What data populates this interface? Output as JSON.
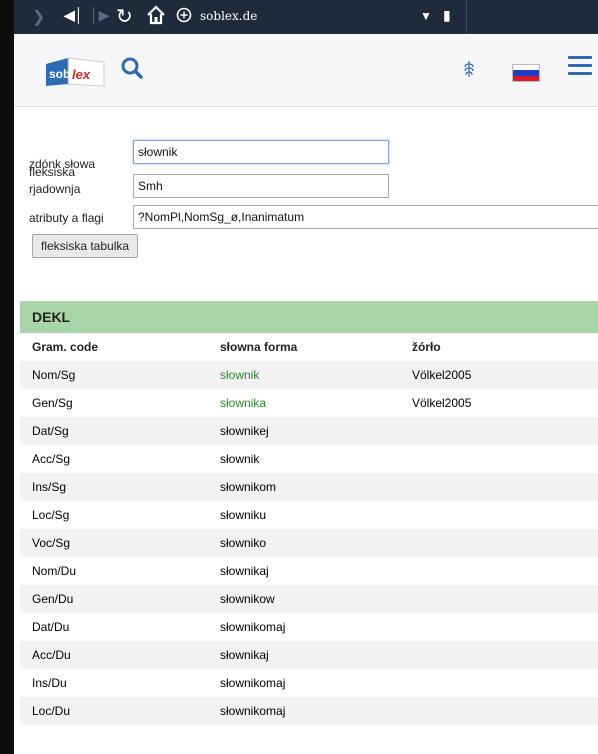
{
  "browser": {
    "domain": "soblex.de",
    "forward_icon": "chevron-right-icon",
    "skip_back_icon": "skip-back-icon",
    "skip_forward_icon": "skip-forward-icon",
    "reload_icon": "reload-icon",
    "home_icon": "home-icon",
    "site_icon": "site-info-icon",
    "dropdown_icon": "dropdown-icon",
    "bookmark_icon": "bookmark-icon",
    "bar_color": "#1d2b3a"
  },
  "header": {
    "logo_part1": "sob",
    "logo_part2": "lex",
    "search_icon": "search-icon",
    "language_icon": "sorbian-language-icon",
    "flag_icon": "russian-flag-icon",
    "menu_icon": "hamburger-menu-icon",
    "accent_color": "#2b6cb5"
  },
  "form": {
    "stem_label": "zdónk słowa",
    "stem_value": "słownik",
    "inflection_label_line1": "fleksiska",
    "inflection_label_line2": "rjadownja",
    "inflection_value": "Smh",
    "attributes_label": "atributy a flagi",
    "attributes_value": "?NomPl,NomSg_ø,Inanimatum",
    "table_button": "fleksiska tabulka"
  },
  "table": {
    "group": "DEKL",
    "group_color": "#a9d6a9",
    "headers": {
      "code": "Gram. code",
      "form": "słowna forma",
      "source": "žórło"
    },
    "rows": [
      {
        "code": "Nom/Sg",
        "form": "słownik",
        "source": "Völkel2005"
      },
      {
        "code": "Gen/Sg",
        "form": "słownika",
        "source": "Völkel2005"
      },
      {
        "code": "Dat/Sg",
        "form": "słownikej",
        "source": ""
      },
      {
        "code": "Acc/Sg",
        "form": "słownik",
        "source": ""
      },
      {
        "code": "Ins/Sg",
        "form": "słownikom",
        "source": ""
      },
      {
        "code": "Loc/Sg",
        "form": "słowniku",
        "source": ""
      },
      {
        "code": "Voc/Sg",
        "form": "słowniko",
        "source": ""
      },
      {
        "code": "Nom/Du",
        "form": "słownikaj",
        "source": ""
      },
      {
        "code": "Gen/Du",
        "form": "słownikow",
        "source": ""
      },
      {
        "code": "Dat/Du",
        "form": "słownikomaj",
        "source": ""
      },
      {
        "code": "Acc/Du",
        "form": "słownikaj",
        "source": ""
      },
      {
        "code": "Ins/Du",
        "form": "słownikomaj",
        "source": ""
      },
      {
        "code": "Loc/Du",
        "form": "słownikomaj",
        "source": ""
      }
    ]
  }
}
